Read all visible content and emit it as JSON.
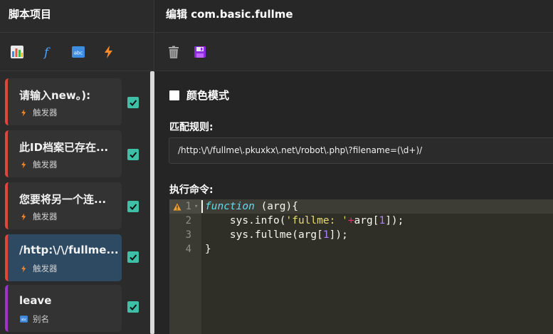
{
  "sidebar": {
    "title": "脚本项目",
    "toolbar": [
      "chart-icon",
      "function-icon",
      "abc-icon",
      "lightning-icon"
    ],
    "items": [
      {
        "title": "请输入new。):",
        "type": "触发器",
        "type_icon": "lightning-icon",
        "checked": true
      },
      {
        "title": "此ID档案已存在...",
        "type": "触发器",
        "type_icon": "lightning-icon",
        "checked": true
      },
      {
        "title": "您要将另一个连...",
        "type": "触发器",
        "type_icon": "lightning-icon",
        "checked": true
      },
      {
        "title": "/http:\\/\\/fullme...",
        "type": "触发器",
        "type_icon": "lightning-icon",
        "checked": true,
        "selected": true
      },
      {
        "title": "leave",
        "type": "别名",
        "type_icon": "abc-icon",
        "checked": true
      }
    ]
  },
  "editor": {
    "title": "编辑 com.basic.fullme",
    "toolbar": [
      "trash-icon",
      "save-icon"
    ],
    "color_mode_label": "颜色模式",
    "color_mode_checked": false,
    "rule_label": "匹配规则:",
    "rule_value": "/http:\\/\\/fullme\\.pkuxkx\\.net\\/robot\\.php\\?filename=(\\d+)/",
    "command_label": "执行命令:",
    "line_numbers": [
      "1",
      "2",
      "3",
      "4"
    ],
    "code": [
      "function (arg){",
      "    sys.info('fullme: '+arg[1]);",
      "    sys.fullme(arg[1]);",
      "}"
    ]
  },
  "colors": {
    "trigger_accent": "#e0453a",
    "alias_accent": "#9b36c2",
    "checkbox": "#3fbfa6",
    "selected_item": "#2d4a62"
  }
}
